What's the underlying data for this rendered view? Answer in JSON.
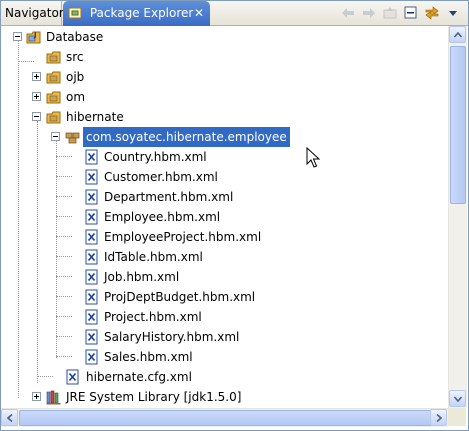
{
  "tabs": {
    "navigator": "Navigator",
    "package_explorer": "Package Explorer",
    "close": "✕"
  },
  "toolbar": {
    "icons": [
      "back-icon",
      "forward-icon",
      "up-icon",
      "collapse-all-icon",
      "link-with-editor-icon",
      "view-menu-icon"
    ]
  },
  "tree": {
    "database": "Database",
    "src": "src",
    "ojb": "ojb",
    "om": "om",
    "hibernate": "hibernate",
    "package": "com.soyatec.hibernate.employee",
    "files": [
      "Country.hbm.xml",
      "Customer.hbm.xml",
      "Department.hbm.xml",
      "Employee.hbm.xml",
      "EmployeeProject.hbm.xml",
      "IdTable.hbm.xml",
      "Job.hbm.xml",
      "ProjDeptBudget.hbm.xml",
      "Project.hbm.xml",
      "SalaryHistory.hbm.xml",
      "Sales.hbm.xml"
    ],
    "cfg": "hibernate.cfg.xml",
    "jre": "JRE System Library [jdk1.5.0]"
  },
  "colors": {
    "selection": "#316ac5",
    "active_tab": "#3a6cc6",
    "folder": "#e8b94a"
  }
}
